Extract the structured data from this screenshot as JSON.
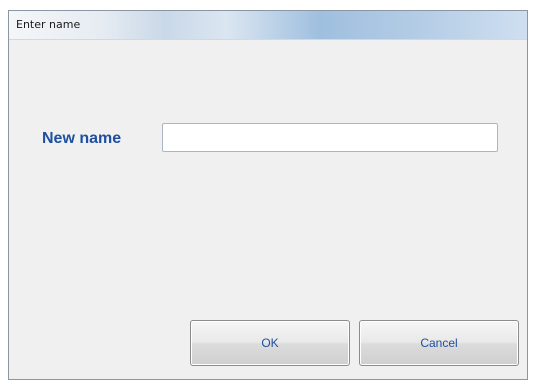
{
  "window": {
    "title": "Enter name"
  },
  "form": {
    "name_label": "New name",
    "name_value": "",
    "name_placeholder": ""
  },
  "buttons": {
    "ok_label": "OK",
    "cancel_label": "Cancel"
  },
  "colors": {
    "label_text": "#1f4fa0",
    "button_text": "#1f4fa0",
    "dialog_background": "#f0f0f0"
  }
}
